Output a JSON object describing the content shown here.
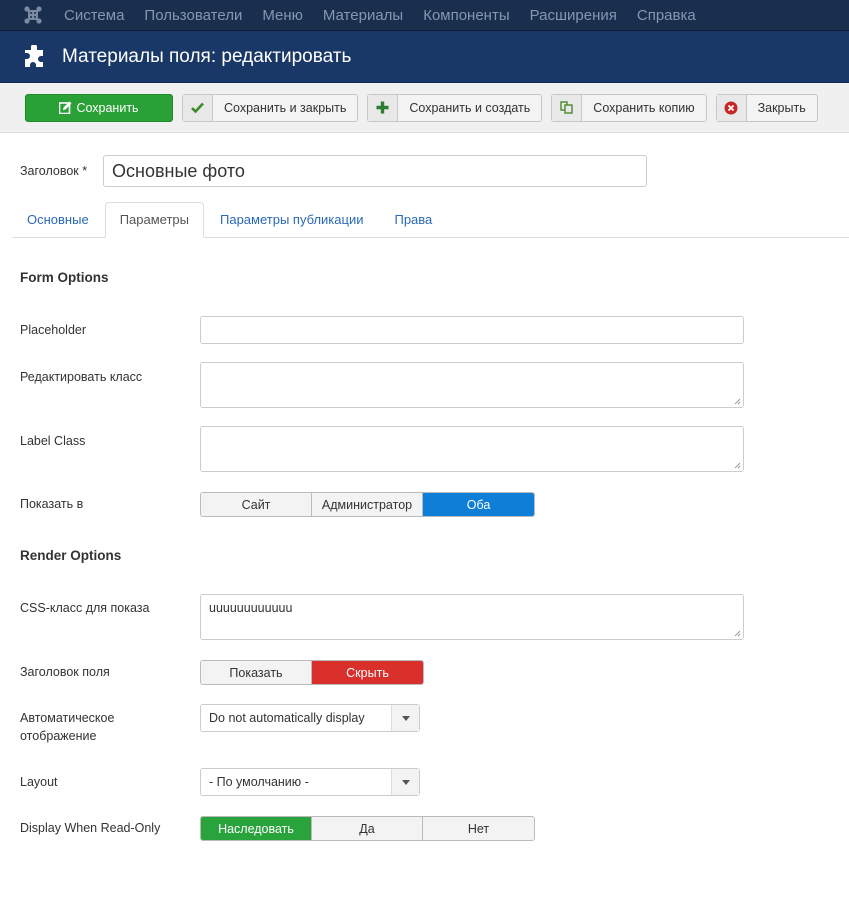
{
  "topnav": {
    "logo_icon": "joomla-logo-icon",
    "items": [
      "Система",
      "Пользователи",
      "Меню",
      "Материалы",
      "Компоненты",
      "Расширения",
      "Справка"
    ]
  },
  "header": {
    "icon": "puzzle-icon",
    "title": "Материалы поля: редактировать"
  },
  "toolbar": {
    "save": {
      "label": "Сохранить",
      "icon": "edit-icon"
    },
    "save_close": {
      "label": "Сохранить и закрыть",
      "icon": "check-icon"
    },
    "save_new": {
      "label": "Сохранить и создать",
      "icon": "plus-icon"
    },
    "save_copy": {
      "label": "Сохранить копию",
      "icon": "copy-icon"
    },
    "close": {
      "label": "Закрыть",
      "icon": "cancel-icon"
    }
  },
  "title_field": {
    "label": "Заголовок *",
    "value": "Основные фото"
  },
  "tabs": [
    {
      "label": "Основные",
      "active": false
    },
    {
      "label": "Параметры",
      "active": true
    },
    {
      "label": "Параметры публикации",
      "active": false
    },
    {
      "label": "Права",
      "active": false
    }
  ],
  "form_options": {
    "title": "Form Options",
    "placeholder": {
      "label": "Placeholder",
      "value": ""
    },
    "edit_class": {
      "label": "Редактировать класс",
      "value": ""
    },
    "label_class": {
      "label": "Label Class",
      "value": ""
    },
    "show_on": {
      "label": "Показать в",
      "options": [
        "Сайт",
        "Администратор",
        "Оба"
      ],
      "selected": "Оба"
    }
  },
  "render_options": {
    "title": "Render Options",
    "render_class": {
      "label": "CSS-класс для показа",
      "value": "uuuuuuuuuuuu"
    },
    "show_label": {
      "label": "Заголовок поля",
      "options": [
        "Показать",
        "Скрыть"
      ],
      "selected": "Скрыть"
    },
    "auto_display": {
      "label": "Автоматическое отображение",
      "value": "Do not automatically display"
    },
    "layout": {
      "label": "Layout",
      "value": "- По умолчанию -"
    },
    "display_readonly": {
      "label": "Display When Read-Only",
      "options": [
        "Наследовать",
        "Да",
        "Нет"
      ],
      "selected": "Наследовать"
    }
  },
  "colors": {
    "topnav_bg": "#1a2f4e",
    "header_bg": "#1a3867",
    "save_green": "#2aa136",
    "active_blue": "#0f7ed7",
    "active_red": "#d9302c",
    "active_green": "#29a33b",
    "link_blue": "#2a69b8"
  }
}
